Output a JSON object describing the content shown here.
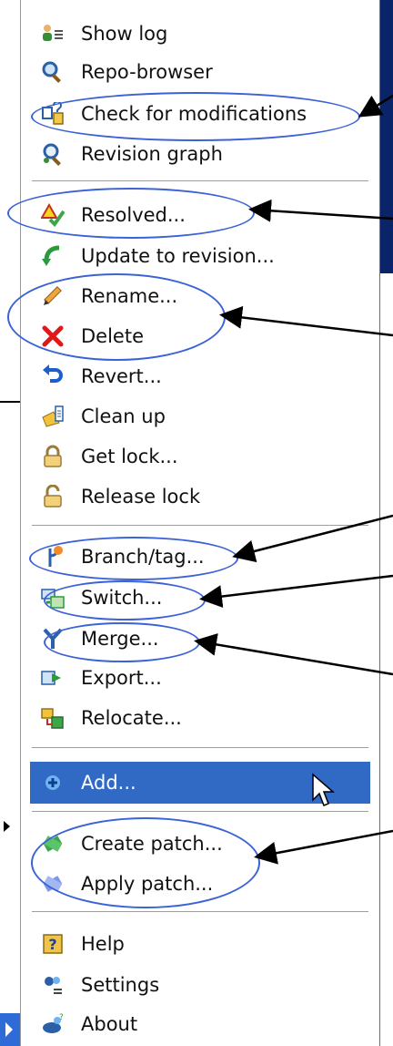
{
  "menu": {
    "items": [
      {
        "key": "show-log",
        "label": "Show log",
        "icon": "show-log-icon"
      },
      {
        "key": "repo-browser",
        "label": "Repo-browser",
        "icon": "repo-browser-icon"
      },
      {
        "key": "check-modifications",
        "label": "Check for modifications",
        "icon": "check-modifications-icon"
      },
      {
        "key": "revision-graph",
        "label": "Revision graph",
        "icon": "revision-graph-icon"
      },
      {
        "key": "resolved",
        "label": "Resolved...",
        "icon": "resolved-icon"
      },
      {
        "key": "update-to-revision",
        "label": "Update to revision...",
        "icon": "update-icon"
      },
      {
        "key": "rename",
        "label": "Rename...",
        "icon": "pencil-icon"
      },
      {
        "key": "delete",
        "label": "Delete",
        "icon": "delete-x-icon"
      },
      {
        "key": "revert",
        "label": "Revert...",
        "icon": "revert-icon"
      },
      {
        "key": "clean-up",
        "label": "Clean up",
        "icon": "clean-up-icon"
      },
      {
        "key": "get-lock",
        "label": "Get lock...",
        "icon": "lock-icon"
      },
      {
        "key": "release-lock",
        "label": "Release lock",
        "icon": "unlock-icon"
      },
      {
        "key": "branch-tag",
        "label": "Branch/tag...",
        "icon": "branch-icon"
      },
      {
        "key": "switch",
        "label": "Switch...",
        "icon": "switch-icon"
      },
      {
        "key": "merge",
        "label": "Merge...",
        "icon": "merge-icon"
      },
      {
        "key": "export",
        "label": "Export...",
        "icon": "export-icon"
      },
      {
        "key": "relocate",
        "label": "Relocate...",
        "icon": "relocate-icon"
      },
      {
        "key": "add",
        "label": "Add...",
        "icon": "add-plus-icon",
        "selected": true
      },
      {
        "key": "create-patch",
        "label": "Create patch...",
        "icon": "create-patch-icon"
      },
      {
        "key": "apply-patch",
        "label": "Apply patch...",
        "icon": "apply-patch-icon"
      },
      {
        "key": "help",
        "label": "Help",
        "icon": "help-icon"
      },
      {
        "key": "settings",
        "label": "Settings",
        "icon": "settings-icon"
      },
      {
        "key": "about",
        "label": "About",
        "icon": "about-icon"
      }
    ]
  },
  "colors": {
    "selection": "#316ac5",
    "annotation": "#3b62d6"
  }
}
